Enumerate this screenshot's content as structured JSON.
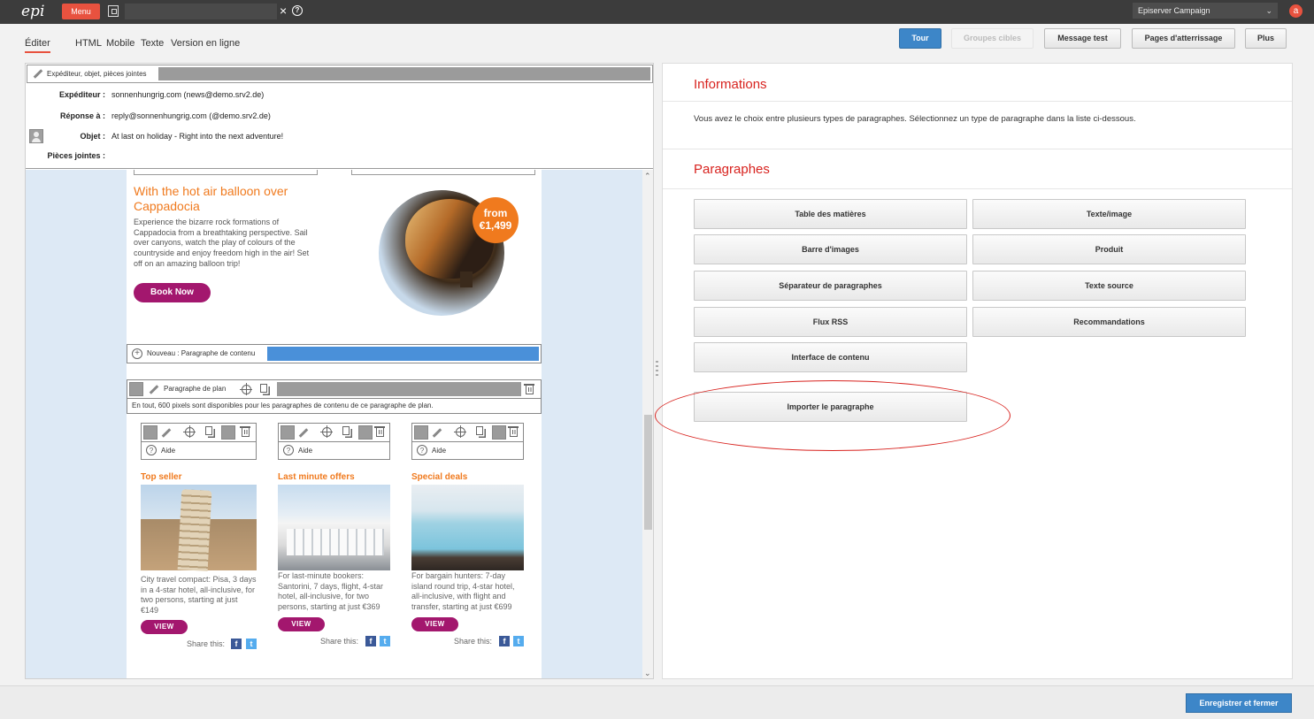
{
  "topbar": {
    "menu_label": "Menu",
    "search_value": "",
    "app_selector": "Episerver Campaign",
    "avatar_letter": "a"
  },
  "tabs": [
    "Éditer",
    "HTML",
    "Mobile",
    "Texte",
    "Version en ligne"
  ],
  "toolbar": {
    "tour": "Tour",
    "groupes_cibles": "Groupes cibles",
    "message_test": "Message test",
    "pages": "Pages d'atterrissage",
    "plus": "Plus"
  },
  "meta": {
    "header_label": "Expéditeur, objet, pièces jointes",
    "expediteur_label": "Expéditeur :",
    "expediteur_value": "sonnenhungrig.com (news@demo.srv2.de)",
    "reponse_label": "Réponse à :",
    "reponse_value": "reply@sonnenhungrig.com (@demo.srv2.de)",
    "objet_label": "Objet :",
    "objet_value": "At last on holiday - Right into the next adventure!",
    "pieces_label": "Pièces jointes :"
  },
  "email": {
    "hero_title": "With the hot air balloon over Cappadocia",
    "hero_text": "Experience the bizarre rock formations of Cappadocia from a breathtaking perspective. Sail over canyons, watch the play of colours of the countryside and enjoy freedom high in the air! Set off on an amazing balloon trip!",
    "book_button": "Book Now",
    "price_from": "from",
    "price_value": "€1,499",
    "new_paragraph": "Nouveau : Paragraphe de contenu",
    "plan_paragraph": "Paragraphe de plan",
    "plan_info": "En tout, 600 pixels sont disponibles pour les paragraphes de contenu de ce paragraphe de plan.",
    "aide": "Aide",
    "columns": [
      {
        "title": "Top seller",
        "text": "City travel compact: Pisa, 3 days in a 4-star hotel, all-inclusive, for two persons, starting at just €149"
      },
      {
        "title": "Last minute offers",
        "text": "For last-minute bookers: Santorini, 7 days, flight, 4-star hotel, all-inclusive, for two persons, starting at just €369"
      },
      {
        "title": "Special deals",
        "text": "For bargain hunters: 7-day island round trip, 4-star hotel, all-inclusive, with flight and transfer, starting at just €699"
      }
    ],
    "view_button": "VIEW",
    "share_label": "Share this:"
  },
  "right": {
    "info_title": "Informations",
    "info_text": "Vous avez le choix entre plusieurs types de paragraphes. Sélectionnez un type de paragraphe dans la liste ci-dessous.",
    "para_title": "Paragraphes",
    "buttons": [
      "Table des matières",
      "Texte/image",
      "Barre d'images",
      "Produit",
      "Séparateur de paragraphes",
      "Texte source",
      "Flux RSS",
      "Recommandations",
      "Interface de contenu",
      "Importer le paragraphe"
    ]
  },
  "footer": {
    "save_close": "Enregistrer et fermer"
  },
  "colors": {
    "accent_red": "#d8231f",
    "orange": "#f07a1e",
    "magenta": "#a3176e",
    "blue": "#3d86c8"
  }
}
